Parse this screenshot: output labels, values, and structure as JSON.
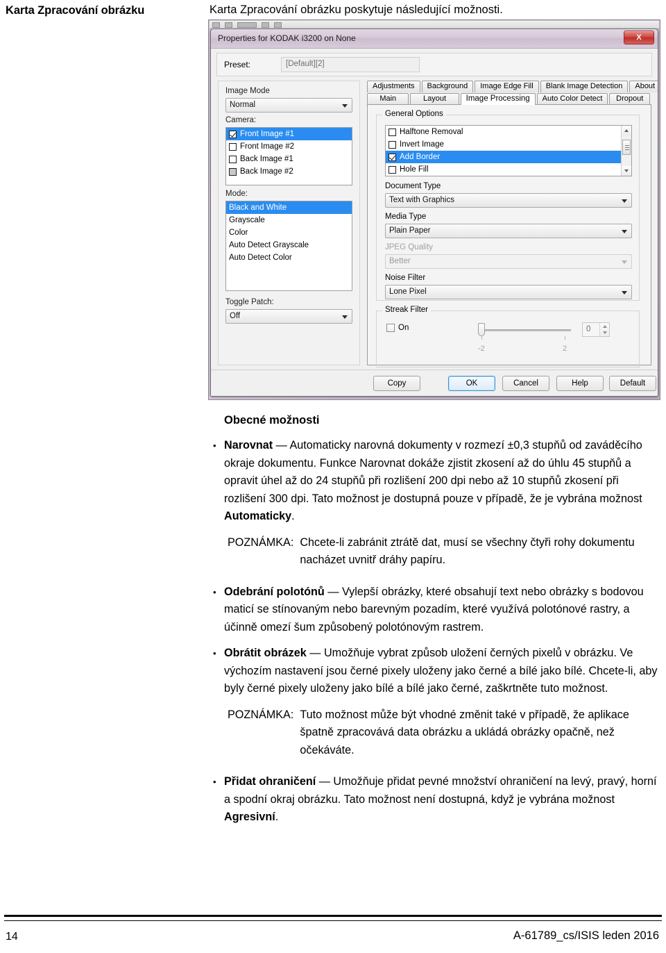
{
  "header": {
    "running_head": "Karta Zpracování obrázku",
    "intro": "Karta Zpracování obrázku poskytuje následující možnosti."
  },
  "dialog": {
    "title": "Properties for KODAK i3200 on None",
    "close_label": "X",
    "preset": {
      "label": "Preset:",
      "value": "[Default][2]"
    },
    "left": {
      "image_mode_label": "Image Mode",
      "image_mode_value": "Normal",
      "camera_label": "Camera:",
      "camera_items": [
        {
          "label": "Front Image #1",
          "checked": true,
          "selected": true,
          "greyed": false
        },
        {
          "label": "Front Image #2",
          "checked": false,
          "selected": false,
          "greyed": false
        },
        {
          "label": "Back Image #1",
          "checked": false,
          "selected": false,
          "greyed": false
        },
        {
          "label": "Back Image #2",
          "checked": false,
          "selected": false,
          "greyed": true
        }
      ],
      "mode_label": "Mode:",
      "mode_items": [
        {
          "label": "Black and White",
          "selected": true
        },
        {
          "label": "Grayscale",
          "selected": false
        },
        {
          "label": "Color",
          "selected": false
        },
        {
          "label": "Auto Detect Grayscale",
          "selected": false
        },
        {
          "label": "Auto Detect Color",
          "selected": false
        }
      ],
      "toggle_patch_label": "Toggle Patch:",
      "toggle_patch_value": "Off"
    },
    "tabs_row1": [
      {
        "label": "Adjustments",
        "active": false
      },
      {
        "label": "Background",
        "active": false
      },
      {
        "label": "Image Edge Fill",
        "active": false
      },
      {
        "label": "Blank Image Detection",
        "active": false
      },
      {
        "label": "About",
        "active": false
      }
    ],
    "tabs_row2": [
      {
        "label": "Main",
        "active": false
      },
      {
        "label": "Layout",
        "active": false
      },
      {
        "label": "Image Processing",
        "active": true
      },
      {
        "label": "Auto Color Detect",
        "active": false
      },
      {
        "label": "Dropout",
        "active": false
      }
    ],
    "general_options": {
      "group_label": "General Options",
      "items": [
        {
          "label": "Halftone Removal",
          "checked": false,
          "selected": false
        },
        {
          "label": "Invert Image",
          "checked": false,
          "selected": false
        },
        {
          "label": "Add Border",
          "checked": true,
          "selected": true
        },
        {
          "label": "Hole Fill",
          "checked": false,
          "selected": false
        }
      ],
      "document_type_label": "Document Type",
      "document_type_value": "Text with Graphics",
      "media_type_label": "Media Type",
      "media_type_value": "Plain Paper",
      "jpeg_quality_label": "JPEG Quality",
      "jpeg_quality_value": "Better",
      "noise_filter_label": "Noise Filter",
      "noise_filter_value": "Lone Pixel"
    },
    "streak_filter": {
      "group_label": "Streak Filter",
      "on_label": "On",
      "on_checked": false,
      "slider_min_label": "-2",
      "slider_max_label": "2",
      "value": "0"
    },
    "buttons": {
      "copy": "Copy",
      "ok": "OK",
      "cancel": "Cancel",
      "help": "Help",
      "default": "Default"
    }
  },
  "body": {
    "heading": "Obecné možnosti",
    "bullet1_term": "Narovnat",
    "bullet1_dash": " — ",
    "bullet1_text_a": "Automaticky narovná dokumenty v rozmezí ±0,3 stupňů od zaváděcího okraje dokumentu. Funkce Narovnat dokáže zjistit zkosení až do úhlu 45 stupňů a opravit úhel až do 24 stupňů při rozlišení 200 dpi nebo až 10 stupňů zkosení při rozlišení 300 dpi. Tato možnost je dostupná pouze v případě, že je vybrána možnost ",
    "bullet1_term_b": "Automaticky",
    "bullet1_text_b": ".",
    "note1_label": "POZNÁMKA:",
    "note1_text": "Chcete-li zabránit ztrátě dat, musí se všechny čtyři rohy dokumentu nacházet uvnitř dráhy papíru.",
    "bullet2_term": "Odebrání polotónů",
    "bullet2_dash": " — ",
    "bullet2_text": "Vylepší obrázky, které obsahují text nebo obrázky s bodovou maticí se stínovaným nebo barevným pozadím, které využívá polotónové rastry, a účinně omezí šum způsobený polotónovým rastrem.",
    "bullet3_term": "Obrátit obrázek",
    "bullet3_dash": " — ",
    "bullet3_text": "Umožňuje vybrat způsob uložení černých pixelů v obrázku. Ve výchozím nastavení jsou černé pixely uloženy jako černé a bílé jako bílé. Chcete-li, aby byly černé pixely uloženy jako bílé a bílé jako černé, zaškrtněte tuto možnost.",
    "note2_label": "POZNÁMKA:",
    "note2_text": "Tuto možnost může být vhodné změnit také v případě, že aplikace špatně zpracovává data obrázku a ukládá obrázky opačně, než očekáváte.",
    "bullet4_term": "Přidat ohraničení",
    "bullet4_dash": " — ",
    "bullet4_text_a": "Umožňuje přidat pevné množství ohraničení na levý, pravý, horní a spodní okraj obrázku. Tato možnost není dostupná, když je vybrána možnost ",
    "bullet4_term_b": "Agresivní",
    "bullet4_text_b": "."
  },
  "footer": {
    "page_number": "14",
    "doc_id": "A-61789_cs/ISIS leden 2016"
  }
}
